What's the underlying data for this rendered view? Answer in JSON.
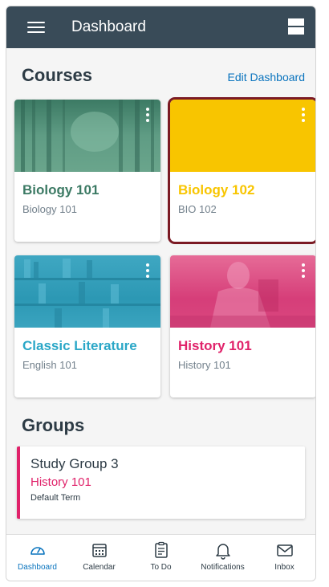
{
  "appbar": {
    "title": "Dashboard"
  },
  "courses": {
    "title": "Courses",
    "edit_label": "Edit Dashboard",
    "cards": [
      {
        "title": "Biology 101",
        "code": "Biology 101",
        "color": "#3c7a64"
      },
      {
        "title": "Biology 102",
        "code": "BIO 102",
        "color": "#f8c500"
      },
      {
        "title": "Classic Literature",
        "code": "English 101",
        "color": "#2ba7c7"
      },
      {
        "title": "History 101",
        "code": "History 101",
        "color": "#e0226a"
      }
    ]
  },
  "groups": {
    "title": "Groups",
    "items": [
      {
        "name": "Study Group 3",
        "course": "History 101",
        "term": "Default Term"
      }
    ]
  },
  "tabs": [
    {
      "label": "Dashboard",
      "icon": "dashboard-icon",
      "active": true
    },
    {
      "label": "Calendar",
      "icon": "calendar-icon"
    },
    {
      "label": "To Do",
      "icon": "todo-icon"
    },
    {
      "label": "Notifications",
      "icon": "bell-icon"
    },
    {
      "label": "Inbox",
      "icon": "inbox-icon"
    }
  ],
  "colors": {
    "appbar": "#394b58",
    "accent": "#0a74be",
    "selected_border": "#7b1a24"
  }
}
